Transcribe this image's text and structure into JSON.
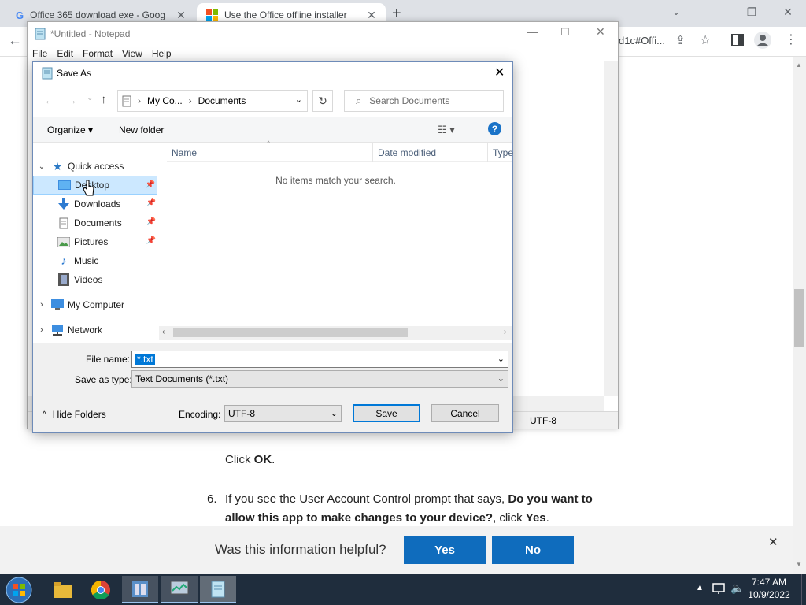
{
  "browser": {
    "tabs": [
      {
        "label": "Office 365 download exe - Goog"
      },
      {
        "label": "Use the Office offline installer"
      }
    ],
    "url_fragment": "d1c#Offi..."
  },
  "page": {
    "click_prefix": "Click ",
    "click_bold": "OK",
    "click_suffix": ".",
    "step_number": "6.",
    "step_text_a": "If you see the User Account Control prompt that says, ",
    "step_bold": "Do you want to allow this app to make changes to your device?",
    "step_text_b": ", click ",
    "step_bold2": "Yes",
    "step_text_c": "."
  },
  "feedback": {
    "question": "Was this information helpful?",
    "yes_label": "Yes",
    "no_label": "No"
  },
  "notepad": {
    "title": "*Untitled - Notepad",
    "menu": [
      "File",
      "Edit",
      "Format",
      "View",
      "Help"
    ],
    "status_encoding": "UTF-8"
  },
  "save_as": {
    "title": "Save As",
    "breadcrumb": [
      "My Co...",
      "Documents"
    ],
    "search_placeholder": "Search Documents",
    "organize_label": "Organize",
    "new_folder_label": "New folder",
    "nav": {
      "quick_access": "Quick access",
      "items": [
        {
          "label": "Desktop",
          "icon": "desktop-icon"
        },
        {
          "label": "Downloads",
          "icon": "download-arrow-icon"
        },
        {
          "label": "Documents",
          "icon": "document-icon"
        },
        {
          "label": "Pictures",
          "icon": "picture-icon"
        },
        {
          "label": "Music",
          "icon": "music-note-icon"
        },
        {
          "label": "Videos",
          "icon": "film-icon"
        }
      ],
      "my_computer": "My Computer",
      "network": "Network"
    },
    "columns": [
      "Name",
      "Date modified",
      "Type"
    ],
    "empty_message": "No items match your search.",
    "file_name_label": "File name:",
    "file_name_value": "*.txt",
    "save_type_label": "Save as type:",
    "save_type_value": "Text Documents (*.txt)",
    "hide_folders_label": "Hide Folders",
    "encoding_label": "Encoding:",
    "encoding_value": "UTF-8",
    "save_label": "Save",
    "cancel_label": "Cancel"
  },
  "taskbar": {
    "time": "7:47 AM",
    "date": "10/9/2022"
  }
}
